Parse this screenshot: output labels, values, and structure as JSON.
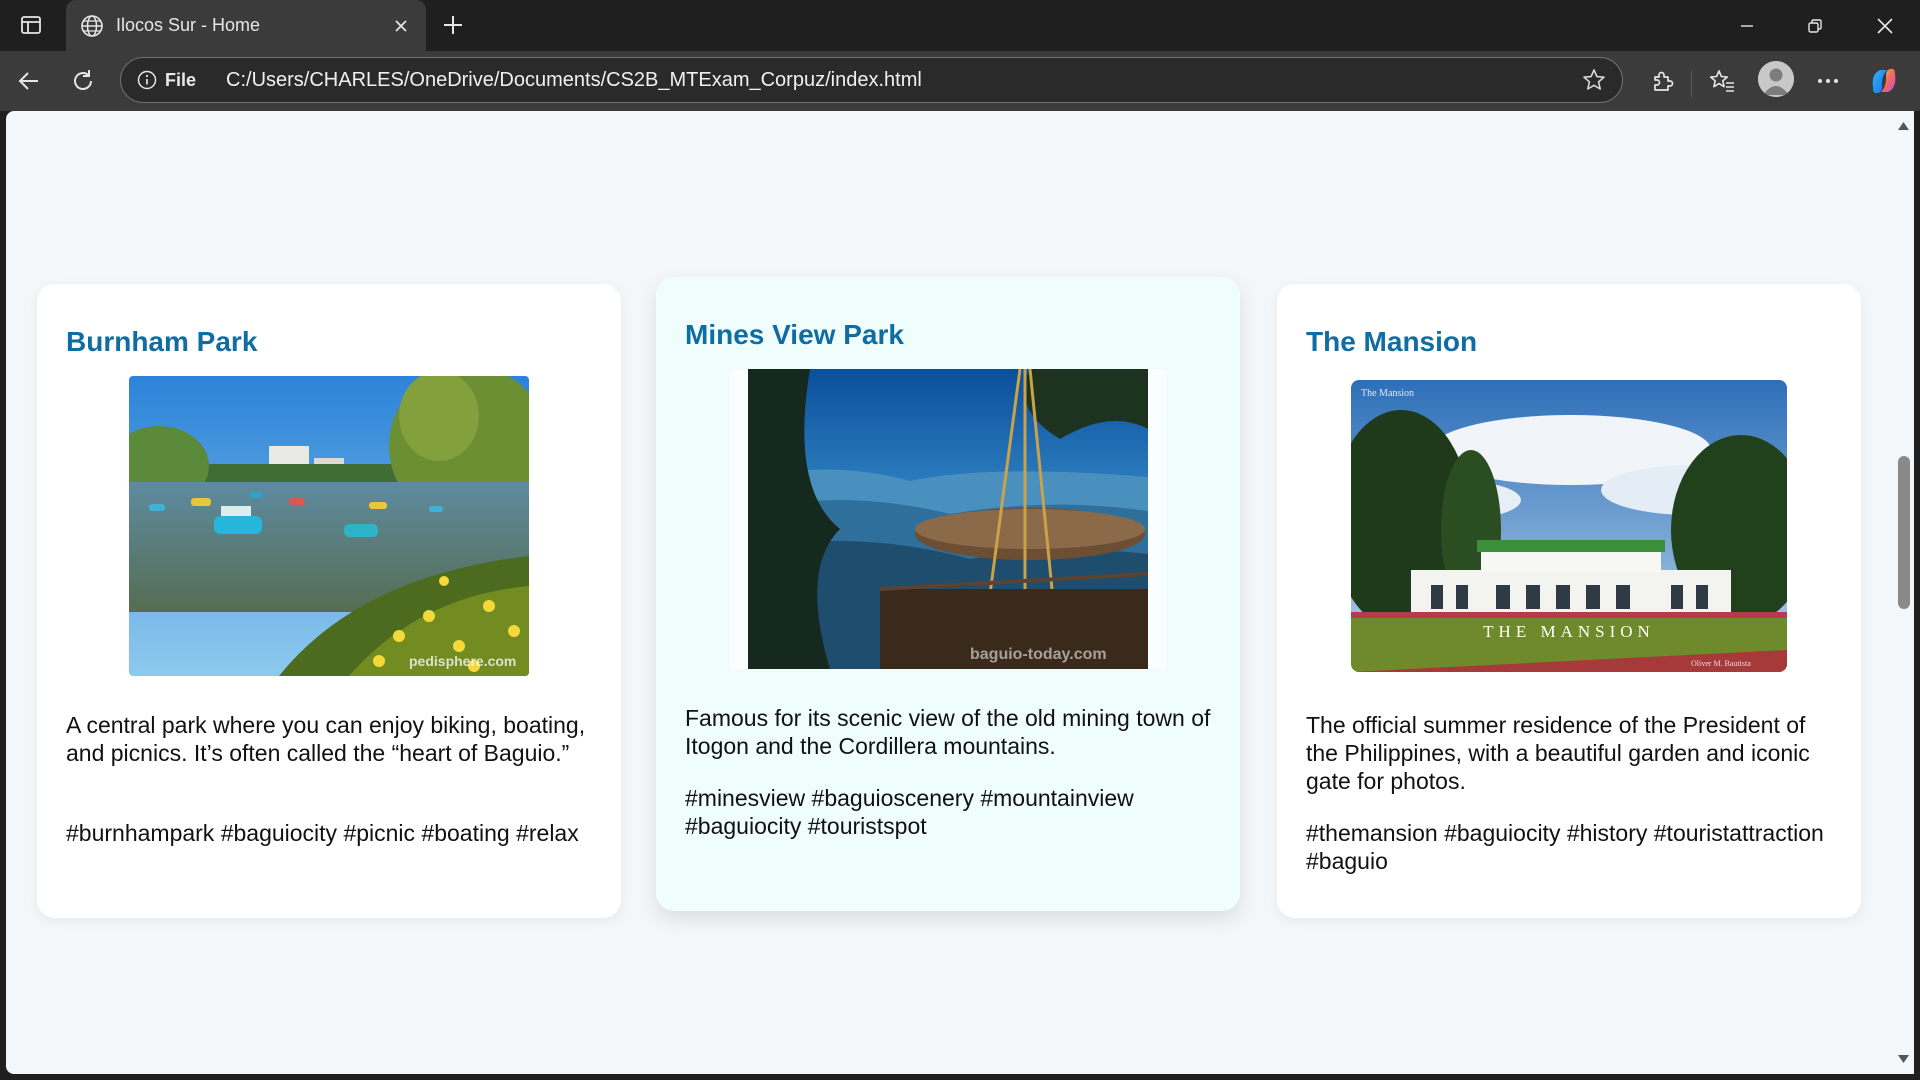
{
  "browser": {
    "tab_title": "Ilocos Sur - Home",
    "address_scheme_label": "File",
    "url": "C:/Users/CHARLES/OneDrive/Documents/CS2B_MTExam_Corpuz/index.html",
    "icons": [
      "tab-actions-icon",
      "globe-icon",
      "close-icon",
      "new-tab-icon",
      "minimize-icon",
      "restore-icon",
      "window-close-icon",
      "back-icon",
      "refresh-icon",
      "info-icon",
      "favorite-star-icon",
      "extensions-icon",
      "favorites-icon",
      "profile-avatar",
      "more-options-icon",
      "copilot-icon"
    ]
  },
  "colors": {
    "heading": "#0f6da3",
    "page_background": "#f4f7fa",
    "card_background": "#ffffff",
    "highlight_card_background": "#effdfd",
    "browser_chrome": "#1f1f1f"
  },
  "cards": [
    {
      "title": "Burnham Park",
      "description": "A central park where you can enjoy biking, boating, and picnics. It’s often called the “heart of Baguio.”",
      "tags": "#burnhampark #baguiocity #picnic #boating #relax",
      "image_watermark": "pedisphere.com"
    },
    {
      "title": "Mines View Park",
      "description": "Famous for its scenic view of the old mining town of Itogon and the Cordillera mountains.",
      "tags": "#minesview #baguioscenery #mountainview #baguiocity #touristspot",
      "image_watermark": "baguio-today.com"
    },
    {
      "title": "The Mansion",
      "description": "The official summer residence of the President of the Philippines, with a beautiful garden and iconic gate for photos.",
      "tags": "#themansion #baguiocity #history #touristattraction #baguio",
      "image_caption": "THE MANSION",
      "image_watermark": "Oliver M. Bautista",
      "image_corner_text": "The Mansion"
    }
  ]
}
